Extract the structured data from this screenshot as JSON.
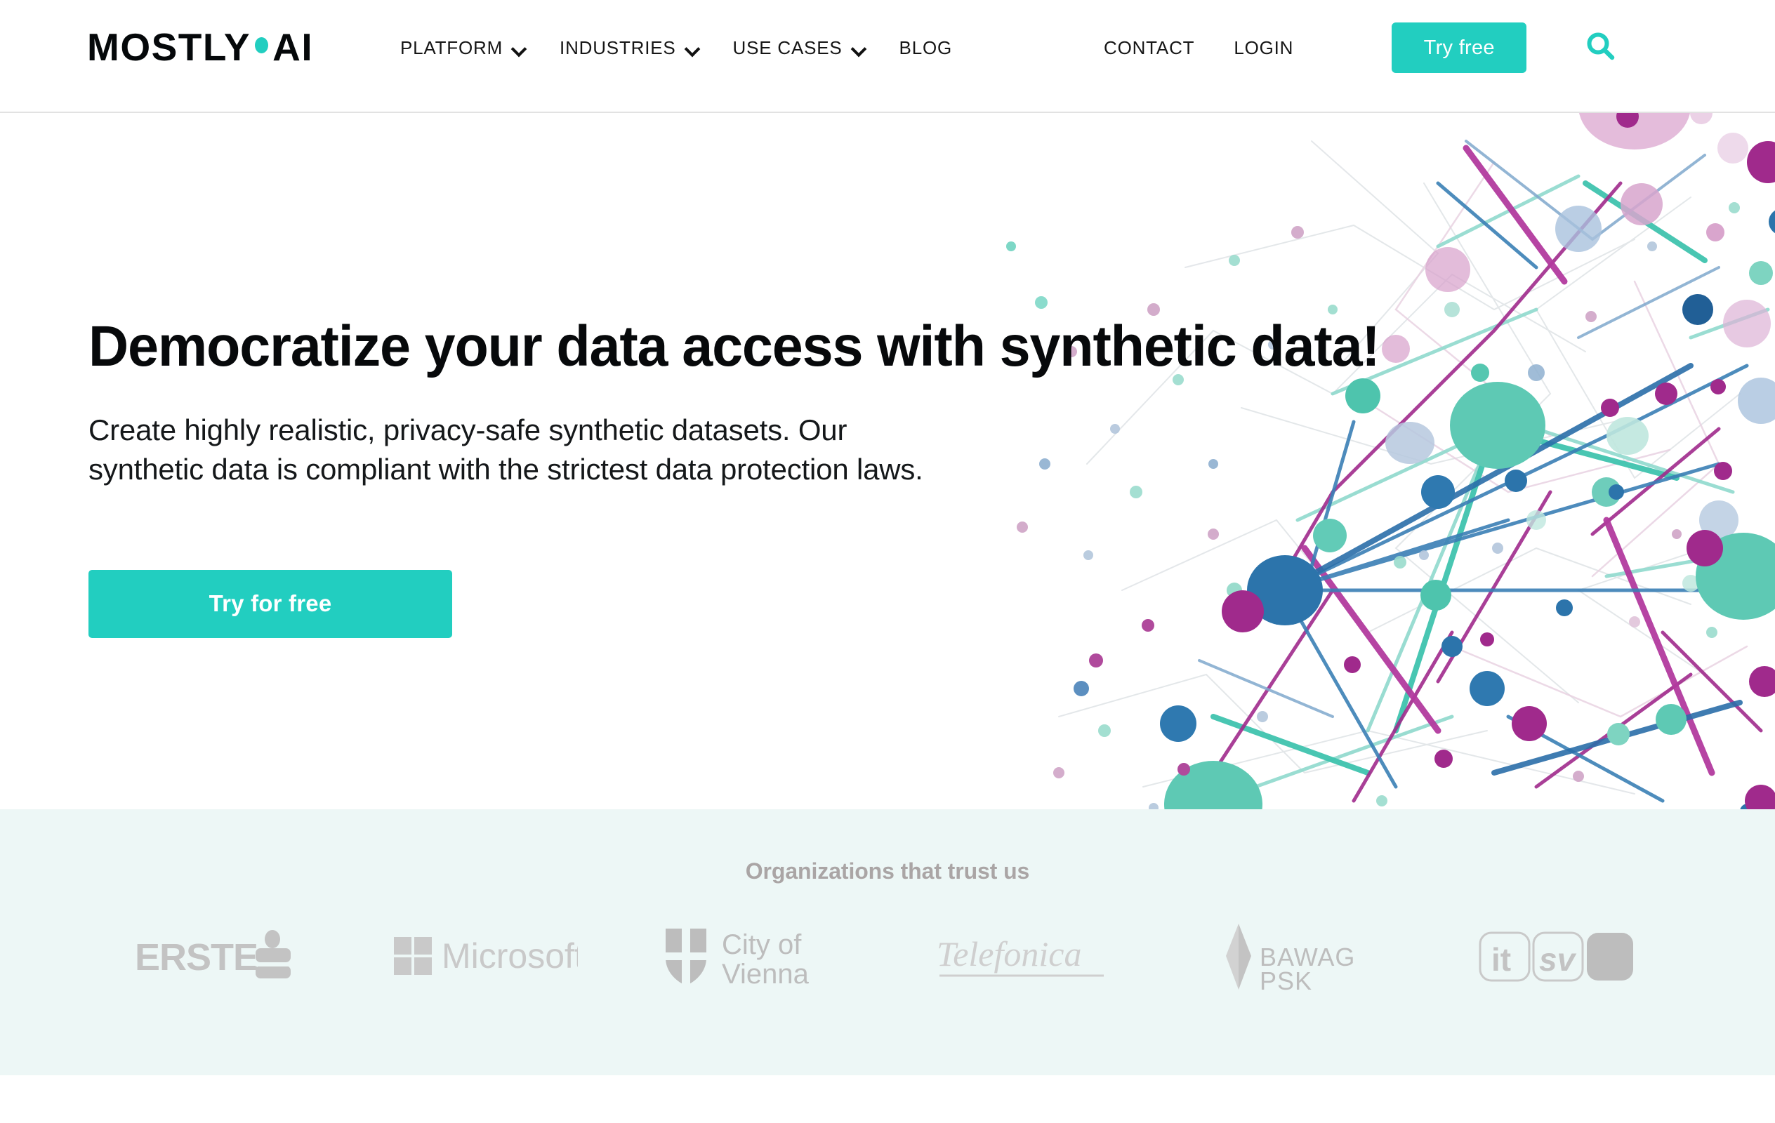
{
  "header": {
    "brand": {
      "part1": "MOSTLY",
      "part2": "AI",
      "dot_color": "#22cec0"
    },
    "nav": [
      {
        "label": "PLATFORM",
        "has_dropdown": true
      },
      {
        "label": "INDUSTRIES",
        "has_dropdown": true
      },
      {
        "label": "USE CASES",
        "has_dropdown": true
      },
      {
        "label": "BLOG",
        "has_dropdown": false
      }
    ],
    "contact_label": "CONTACT",
    "login_label": "LOGIN",
    "try_free_label": "Try free",
    "search_icon": "search-icon"
  },
  "hero": {
    "title": "Democratize your data access with synthetic data!",
    "subtitle": "Create highly realistic, privacy-safe synthetic datasets. Our synthetic data is compliant with the strictest data protection laws.",
    "cta_label": "Try for free"
  },
  "trust": {
    "title": "Organizations that trust us",
    "logos": [
      {
        "name": "Erste",
        "text": "ERSTE"
      },
      {
        "name": "Microsoft",
        "text": "Microsoft"
      },
      {
        "name": "City of Vienna",
        "line1": "City of",
        "line2": "Vienna"
      },
      {
        "name": "Telefonica",
        "text": "Telefonica"
      },
      {
        "name": "BAWAG PSK",
        "line1": "BAWAG",
        "line2": "PSK"
      },
      {
        "name": "itSV",
        "text_it": "it",
        "text_sv": "sv"
      }
    ]
  },
  "colors": {
    "accent_teal": "#22cec0",
    "band_background": "#edf7f6",
    "logo_grey": "#c3c3c3",
    "text_dark": "#15181a"
  }
}
